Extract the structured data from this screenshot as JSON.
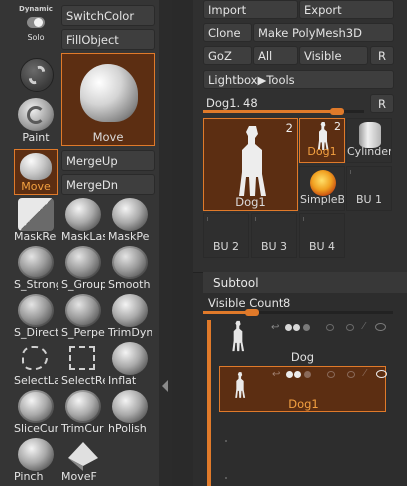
{
  "left": {
    "dynamic_label": "Dynamic",
    "solo_label": "Solo",
    "switch_color": "SwitchColor",
    "fill_object": "FillObject",
    "paint_label": "Paint",
    "move_label": "Move",
    "current_brush_label": "Move",
    "merge_up": "MergeUp",
    "merge_dn": "MergeDn",
    "brushes": [
      {
        "label": "MaskRe",
        "icon": "mask-rect-icon"
      },
      {
        "label": "MaskLas",
        "icon": "mask-lasso-icon"
      },
      {
        "label": "MaskPe",
        "icon": "mask-pen-icon"
      },
      {
        "label": "S_Strong",
        "icon": "sculpt-sphere-icon"
      },
      {
        "label": "S_Group",
        "icon": "sculpt-sphere-icon"
      },
      {
        "label": "Smooth",
        "icon": "sculpt-sphere-icon"
      },
      {
        "label": "S_Direct",
        "icon": "sculpt-sphere-icon"
      },
      {
        "label": "S_Perpe",
        "icon": "sculpt-sphere-icon"
      },
      {
        "label": "TrimDyn",
        "icon": "sphere-icon"
      },
      {
        "label": "SelectLa",
        "icon": "select-lasso-icon"
      },
      {
        "label": "SelectRe",
        "icon": "select-rect-icon"
      },
      {
        "label": "Inflat",
        "icon": "sphere-icon"
      },
      {
        "label": "SliceCur",
        "icon": "slice-curve-icon"
      },
      {
        "label": "TrimCur",
        "icon": "trim-curve-icon"
      },
      {
        "label": "hPolish",
        "icon": "sphere-icon"
      },
      {
        "label": "Pinch",
        "icon": "sphere-icon"
      },
      {
        "label": "MoveF",
        "icon": "move-topological-icon"
      }
    ]
  },
  "right": {
    "import": "Import",
    "export": "Export",
    "clone": "Clone",
    "make_polymesh": "Make PolyMesh3D",
    "goz": "GoZ",
    "all": "All",
    "visible": "Visible",
    "r": "R",
    "lightbox_tools": "Lightbox▶Tools",
    "slider_name": "Dog1.",
    "slider_value": "48",
    "slider_fraction": 0.83,
    "current_tool": {
      "label": "Dog1",
      "count": "2"
    },
    "tools": [
      {
        "label": "Dog1",
        "count": "2",
        "selected": true
      },
      {
        "label": "Cylinder",
        "count": ""
      },
      {
        "label": "SimpleB",
        "count": ""
      },
      {
        "label": "BU 1",
        "count": ""
      },
      {
        "label": "BU 2",
        "count": ""
      },
      {
        "label": "BU 3",
        "count": ""
      },
      {
        "label": "BU 4",
        "count": ""
      }
    ]
  },
  "subtool": {
    "title": "Subtool",
    "visible_count_label": "Visible Count",
    "visible_count_value": "8",
    "visible_count_fraction": 0.26,
    "items": [
      {
        "label": "Dog",
        "selected": false
      },
      {
        "label": "Dog1",
        "selected": true
      }
    ]
  },
  "colors": {
    "accent": "#e07a2a",
    "accent_text": "#f3a040",
    "selected_bg": "#5c2e12",
    "panel": "#353535",
    "button": "#3e3e3e"
  }
}
